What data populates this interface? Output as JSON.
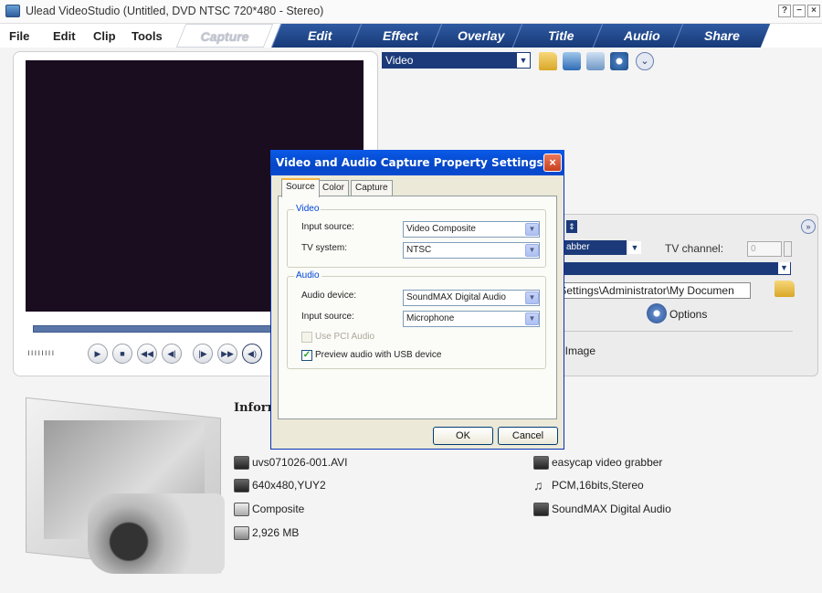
{
  "window": {
    "title": "Ulead VideoStudio (Untitled, DVD NTSC 720*480 - Stereo)",
    "help": "?",
    "minimize": "−",
    "close": "×"
  },
  "menu": [
    "File",
    "Edit",
    "Clip",
    "Tools"
  ],
  "mode_tabs": [
    "Capture",
    "Edit",
    "Effect",
    "Overlay",
    "Title",
    "Audio",
    "Share"
  ],
  "toolbar": {
    "source_value": "Video",
    "dropdown_glyph": "▼",
    "expand_glyph": "⌄"
  },
  "playback": {
    "jog": "ıııııııı",
    "buttons": [
      "▶",
      "■",
      "◀◀",
      "◀|",
      "|▶",
      "▶▶",
      "◀)"
    ]
  },
  "capture_panel": {
    "spinner_glyph": "⇕",
    "device_partial": "abber",
    "tv_channel_label": "TV channel:",
    "tv_channel_value": "0",
    "capture_folder": "and Settings\\Administrator\\My Documen",
    "options_label": "Options",
    "capture_image_label": "ure Image",
    "collapse_glyph": "»"
  },
  "info": {
    "heading": "Inform",
    "left": [
      {
        "icon": "film-icon",
        "text": "uvs071026-001.AVI"
      },
      {
        "icon": "film-info-icon",
        "text": "640x480,YUY2"
      },
      {
        "icon": "check-box-icon",
        "text": "Composite"
      },
      {
        "icon": "disk-clock-icon",
        "text": "2,926 MB"
      }
    ],
    "right": [
      {
        "icon": "monitor-icon",
        "text": "easycap video grabber"
      },
      {
        "icon": "audio-info-icon",
        "text": "PCM,16bits,Stereo"
      },
      {
        "icon": "audio-device-icon",
        "text": "SoundMAX Digital Audio"
      }
    ]
  },
  "dialog": {
    "title": "Video and Audio Capture Property Settings",
    "close": "×",
    "tabs": [
      "Source",
      "Color",
      "Capture"
    ],
    "video_group": "Video",
    "input_source_label": "Input source:",
    "input_source_value": "Video Composite",
    "tv_system_label": "TV system:",
    "tv_system_value": "NTSC",
    "audio_group": "Audio",
    "audio_device_label": "Audio device:",
    "audio_device_value": "SoundMAX Digital Audio",
    "audio_input_label": "Input source:",
    "audio_input_value": "Microphone",
    "use_pci_audio": "Use PCI Audio",
    "preview_usb": "Preview audio with USB device",
    "ok": "OK",
    "cancel": "Cancel"
  }
}
